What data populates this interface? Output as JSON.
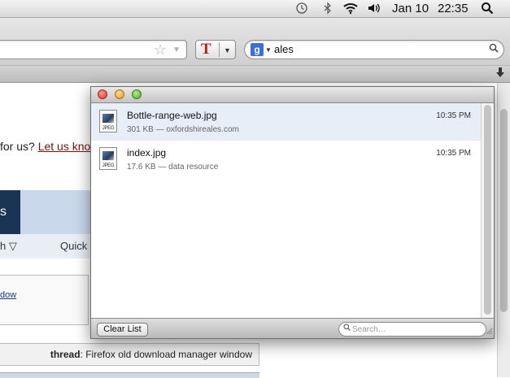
{
  "menubar": {
    "time_machine_icon": "clock-icon",
    "bluetooth_icon": "bluetooth-icon",
    "wifi_icon": "wifi-icon",
    "volume_icon": "volume-icon",
    "date": "Jan 10",
    "time": "22:35",
    "spotlight_icon": "magnifier-icon"
  },
  "toolbar": {
    "bookmark_star": "☆",
    "url_dropdown": "▼",
    "extension_label": "T",
    "extension_menu": "▼",
    "search_engine_logo": "g",
    "search_engine_menu": "▼",
    "search_query": "ales",
    "search_button": "⚲",
    "downloads_icon": "🡇"
  },
  "page": {
    "prompt_text": "for us? ",
    "prompt_link": "Let us know",
    "nav_tab_partial": "s",
    "subnav_item_1": "h ▽",
    "subnav_item_2": "Quick",
    "sidebar_link": "dow",
    "thread_label": "thread",
    "thread_title": ": Firefox old download manager window"
  },
  "downloads": {
    "items": [
      {
        "filename": "Bottle-range-web.jpg",
        "meta": "301 KB — oxfordshireales.com",
        "time": "10:35 PM",
        "file_type": "JPEG",
        "selected": true
      },
      {
        "filename": "index.jpg",
        "meta": "17.6 KB — data resource",
        "time": "10:35 PM",
        "file_type": "JPEG",
        "selected": false
      }
    ],
    "clear_label": "Clear List",
    "search_placeholder": "Search…"
  }
}
